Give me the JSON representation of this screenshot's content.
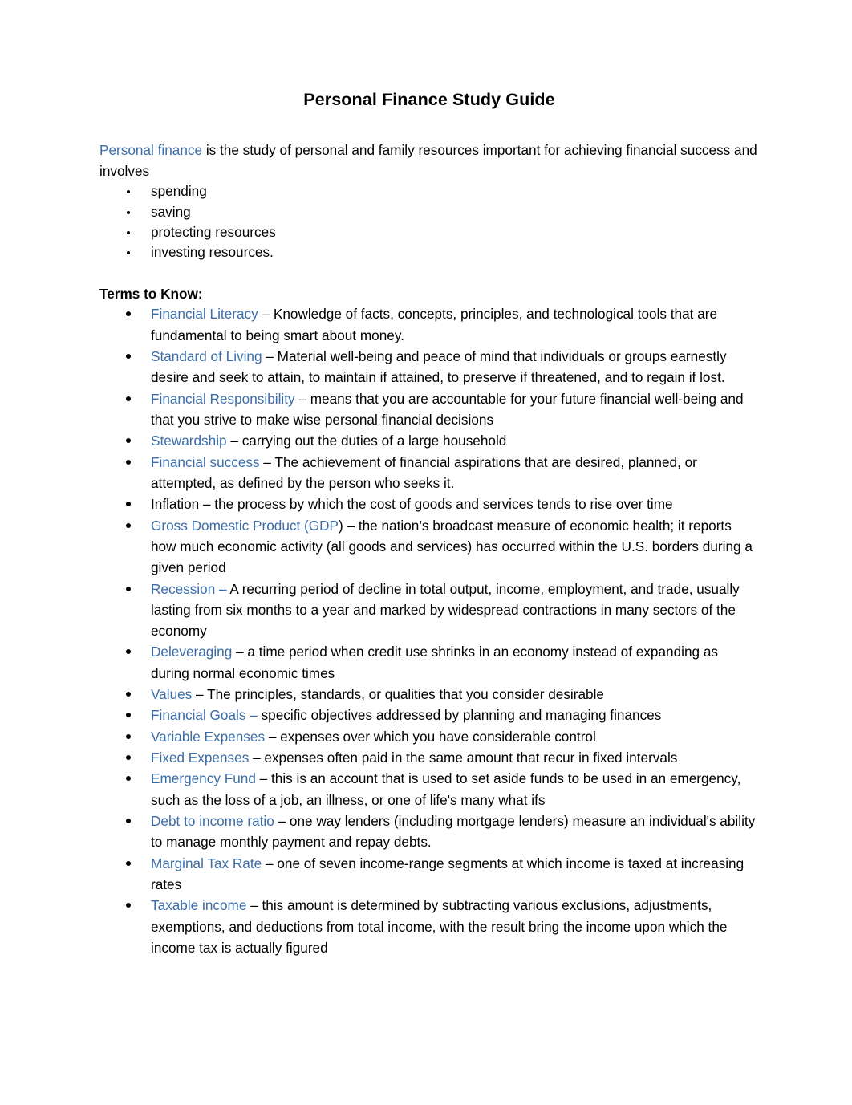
{
  "document": {
    "title": "Personal Finance Study Guide",
    "intro": {
      "term": "Personal finance",
      "text": " is the study of personal and family resources important for achieving financial success and involves"
    },
    "intro_list": [
      "spending",
      "saving",
      "protecting resources",
      "investing resources."
    ],
    "terms_heading": "Terms to Know:",
    "terms": [
      {
        "term": "Financial Literacy",
        "term_color": "#3B6DA8",
        "definition": " – Knowledge of facts, concepts, principles, and technological tools that are fundamental to being smart about money."
      },
      {
        "term": "Standard of Living",
        "term_color": "#3B6DA8",
        "definition": " – Material well-being and peace of mind that individuals or groups earnestly desire and seek to attain, to maintain if attained, to preserve if threatened, and to regain if lost."
      },
      {
        "term": "Financial Responsibility",
        "term_color": "#3B6DA8",
        "definition": " – means that you are accountable for your future financial well-being and that you strive to make wise personal financial decisions"
      },
      {
        "term": "Stewardship",
        "term_color": "#3B6DA8",
        "definition": " – carrying out the duties of a large household"
      },
      {
        "term": "Financial success",
        "term_color": "#3B6DA8",
        "definition": " – The achievement of financial aspirations that are desired, planned, or attempted, as defined by the person who seeks it."
      },
      {
        "term": "Inflation",
        "term_color": "#000000",
        "definition": " – the process by which the cost of goods and services tends to rise over time"
      },
      {
        "term": "Gross Domestic Product (GDP",
        "term_color": "#3B6DA8",
        "definition": ") – the nation’s broadcast measure of economic health; it reports how much economic activity (all goods and services) has occurred within the U.S. borders during a given period"
      },
      {
        "term": "Recession –",
        "term_color": "#3B6DA8",
        "definition": " A recurring period of decline in total output, income, employment, and trade, usually lasting from six months to a year and marked by widespread contractions in many sectors of the economy"
      },
      {
        "term": "Deleveraging",
        "term_color": "#3B6DA8",
        "definition": " – a time period when credit use shrinks in an economy instead of expanding as during normal economic times"
      },
      {
        "term": "Values",
        "term_color": "#3B6DA8",
        "definition": " – The principles, standards, or qualities that you consider desirable"
      },
      {
        "term": "Financial Goals –",
        "term_color": "#3B6DA8",
        "definition": "  specific objectives addressed by planning and managing finances"
      },
      {
        "term": "Variable Expenses",
        "term_color": "#3B6DA8",
        "definition": " – expenses over which you have considerable control"
      },
      {
        "term": "Fixed Expenses",
        "term_color": "#3B6DA8",
        "definition": " – expenses often paid in the same amount that recur in fixed intervals"
      },
      {
        "term": "Emergency Fund",
        "term_color": "#3B6DA8",
        "definition": " – this is an account that is used to set aside funds to be used in an emergency, such as the loss of a job, an illness, or one of life's many what ifs"
      },
      {
        "term": "Debt to income ratio",
        "term_color": "#3B6DA8",
        "definition": " – one way lenders (including mortgage lenders) measure an individual's ability to manage monthly payment and repay debts."
      },
      {
        "term": "Marginal Tax Rate",
        "term_color": "#3B6DA8",
        "definition": " – one of seven income-range segments at which income is taxed at increasing rates"
      },
      {
        "term": "Taxable income",
        "term_color": "#3B6DA8",
        "definition": " – this amount is determined by subtracting various exclusions, adjustments, exemptions, and deductions from total income, with the result bring the income upon which the income tax is actually figured"
      }
    ]
  }
}
